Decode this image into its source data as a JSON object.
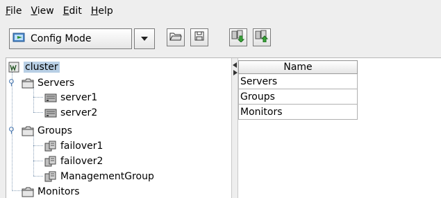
{
  "menu": {
    "items": [
      {
        "mnemonic": "F",
        "rest": "ile"
      },
      {
        "mnemonic": "V",
        "rest": "iew"
      },
      {
        "mnemonic": "E",
        "rest": "dit"
      },
      {
        "mnemonic": "H",
        "rest": "elp"
      }
    ]
  },
  "toolbar": {
    "mode_label": "Config Mode",
    "icons": [
      "mode-icon",
      "chevron-down-icon",
      "open-folder-icon",
      "save-icon",
      "download-config-icon",
      "upload-config-icon"
    ]
  },
  "tree": {
    "root": "cluster",
    "servers_label": "Servers",
    "servers": [
      "server1",
      "server2"
    ],
    "groups_label": "Groups",
    "groups": [
      "failover1",
      "failover2",
      "ManagementGroup"
    ],
    "monitors_label": "Monitors"
  },
  "table": {
    "header": "Name",
    "rows": [
      "Servers",
      "Groups",
      "Monitors"
    ]
  },
  "colors": {
    "selection": "#b8cfe5",
    "background": "#eeeeee"
  }
}
